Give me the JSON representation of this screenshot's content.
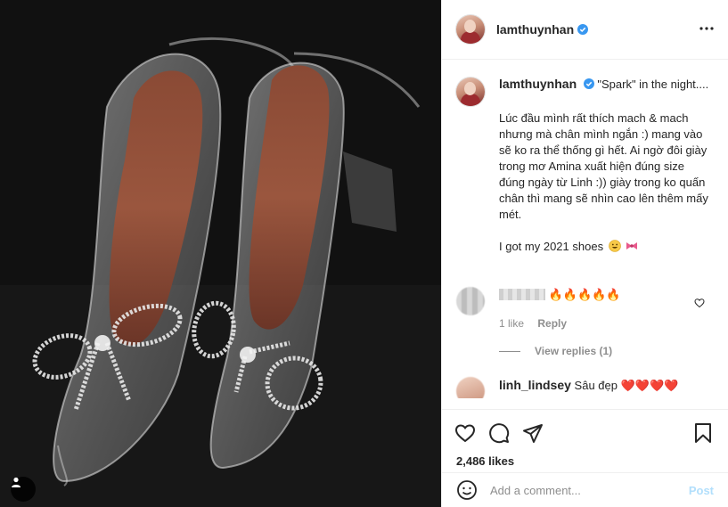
{
  "post": {
    "username": "lamthuynhan",
    "more_icon": "more-horizontal-icon",
    "verified_icon": "verified-badge-icon"
  },
  "caption": {
    "username": "lamthuynhan",
    "title": "\"Spark\" in the night....",
    "body": "Lúc đầu mình rất thích mach & mach nhưng mà chân mình ngắn :) mang vào sẽ ko ra thể thống gì hết. Ai ngờ đôi giày trong mơ Amina xuất hiện đúng size đúng ngày từ Linh :)) giày trong ko quấn chân thì mang sẽ nhìn cao lên thêm mấy mét.",
    "shoes_line": "I got my 2021 shoes",
    "emojis": [
      "grinning-face-emoji",
      "pink-bow-emoji"
    ]
  },
  "comments": [
    {
      "text": "🔥🔥🔥🔥🔥",
      "likes": "1 like",
      "reply": "Reply",
      "view_replies": "View replies (1)"
    },
    {
      "username": "linh_lindsey",
      "text": "Sâu đẹp ❤️❤️❤️❤️"
    }
  ],
  "actions": {
    "likes": "2,486 likes",
    "comment_placeholder": "Add a comment...",
    "post_label": "Post"
  },
  "colors": {
    "link_blue": "#0095f6",
    "post_disabled": "#b2dffc",
    "muted": "#8e8e8e",
    "text": "#262626"
  }
}
